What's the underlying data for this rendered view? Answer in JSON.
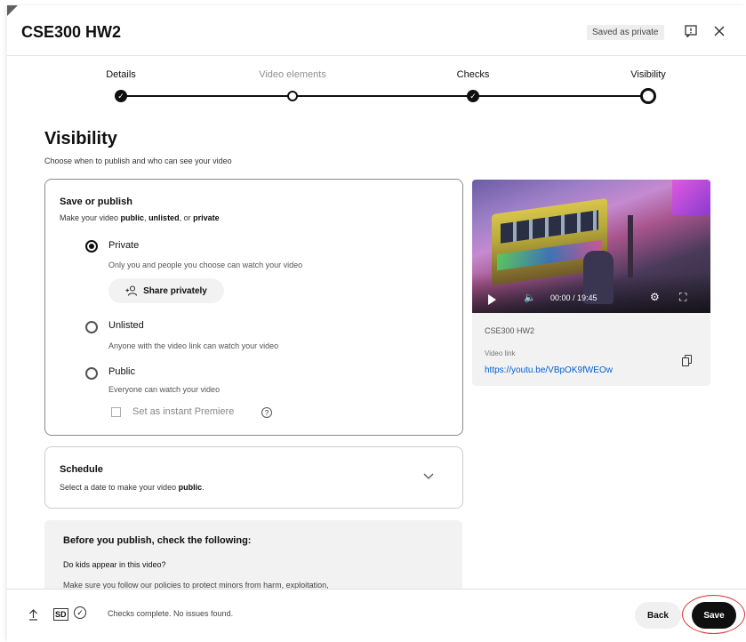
{
  "header": {
    "title": "CSE300 HW2",
    "saved_chip": "Saved as private",
    "feedback_icon": "feedback-icon",
    "close_icon": "close-icon"
  },
  "stepper": {
    "steps": [
      {
        "label": "Details",
        "state": "done"
      },
      {
        "label": "Video elements",
        "state": "open"
      },
      {
        "label": "Checks",
        "state": "done"
      },
      {
        "label": "Visibility",
        "state": "current"
      }
    ]
  },
  "visibility": {
    "heading": "Visibility",
    "subtitle": "Choose when to publish and who can see your video",
    "save_publish": {
      "title": "Save or publish",
      "sub_pre": "Make your video ",
      "sub_public": "public",
      "sub_comma": ", ",
      "sub_unlisted": "unlisted",
      "sub_or": ", or ",
      "sub_private": "private",
      "options": [
        {
          "label": "Private",
          "desc": "Only you and people you choose can watch your video",
          "checked": true
        },
        {
          "label": "Unlisted",
          "desc": "Anyone with the video link can watch your video",
          "checked": false
        },
        {
          "label": "Public",
          "desc": "Everyone can watch your video",
          "checked": false
        }
      ],
      "share_label": "Share privately",
      "premiere_label": "Set as instant Premiere"
    },
    "schedule": {
      "title": "Schedule",
      "sub_pre": "Select a date to make your video ",
      "sub_bold": "public",
      "sub_post": "."
    },
    "notice": {
      "title": "Before you publish, check the following:",
      "question": "Do kids appear in this video?",
      "text": "Make sure you follow our policies to protect minors from harm, exploitation,"
    }
  },
  "preview": {
    "time": "00:00 / 19:45",
    "video_name": "CSE300 HW2",
    "link_label": "Video link",
    "link": "https://youtu.be/VBpOK9fWEOw"
  },
  "footer": {
    "sd_badge": "SD",
    "status": "Checks complete. No issues found.",
    "back_label": "Back",
    "save_label": "Save"
  },
  "colors": {
    "link": "#065fd4",
    "primary_button": "#0f0f0f",
    "highlight_ring": "#dd3333"
  }
}
